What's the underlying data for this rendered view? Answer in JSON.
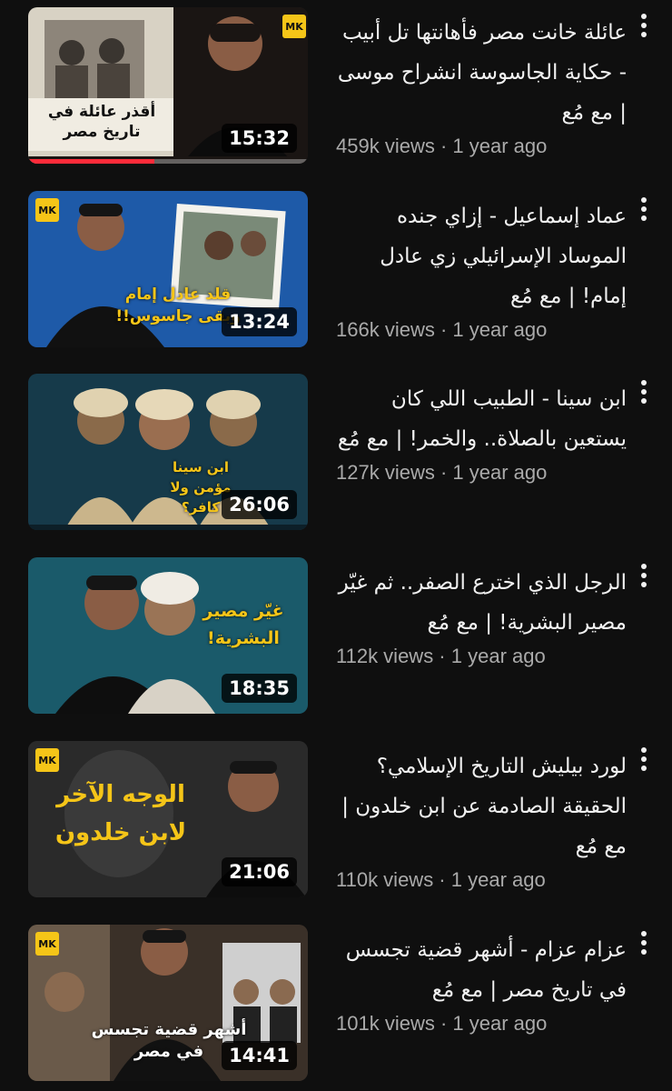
{
  "videos": [
    {
      "title": "عائلة خانت مصر فأهانتها تل أبيب - حكاية الجاسوسة انشراح موسى | مع مُع",
      "stats": "459k views · 1 year ago",
      "duration": "15:32",
      "watched_fraction": 0.45,
      "thumbnail_text": "أقذر عائلة في تاريخ مصر"
    },
    {
      "title": "عماد إسماعيل - إزاي جنده الموساد الإسرائيلي زي عادل إمام! | مع مُع",
      "stats": "166k views · 1 year ago",
      "duration": "13:24",
      "watched_fraction": 0.0,
      "thumbnail_text": "قلد عادل إمام وبقى جاسوس!!"
    },
    {
      "title": "ابن سينا - الطبيب اللي كان يستعين بالصلاة.. والخمر! | مع مُع",
      "stats": "127k views · 1 year ago",
      "duration": "26:06",
      "watched_fraction": 0.0,
      "thumbnail_text": "ابن سينا مؤمن ولا كافر؟"
    },
    {
      "title": "الرجل الذي اخترع الصفر.. ثم غيّر مصير البشرية! | مع مُع",
      "stats": "112k views · 1 year ago",
      "duration": "18:35",
      "watched_fraction": 0.0,
      "thumbnail_text": "غيّر مصير البشرية!"
    },
    {
      "title": "لورد بيليش التاريخ الإسلامي؟ الحقيقة الصادمة عن ابن خلدون | مع مُع",
      "stats": "110k views · 1 year ago",
      "duration": "21:06",
      "watched_fraction": 0.0,
      "thumbnail_text": "الوجه الآخر لابن خلدون"
    },
    {
      "title": "عزام عزام - أشهر قضية تجسس في تاريخ مصر | مع مُع",
      "stats": "101k views · 1 year ago",
      "duration": "14:41",
      "watched_fraction": 0.0,
      "thumbnail_text": "أشهر قضية تجسس في مصر"
    }
  ],
  "icons": {
    "menu": "more-vert-icon",
    "brand": "channel-logo-icon"
  },
  "brand_mark": "MK",
  "colors": {
    "background": "#0f0f0f",
    "progress": "#ff2b3a",
    "meta_text": "#aaaaaa"
  }
}
